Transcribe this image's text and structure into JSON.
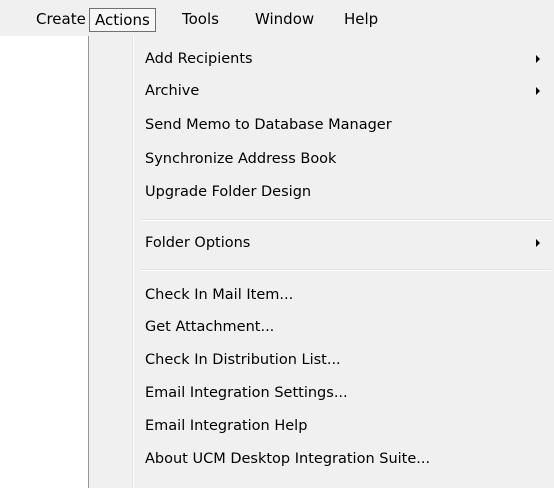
{
  "menubar": {
    "items": [
      {
        "label": "Create"
      },
      {
        "label": "Actions"
      },
      {
        "label": "Tools"
      },
      {
        "label": "Window"
      },
      {
        "label": "Help"
      }
    ]
  },
  "actions_menu": {
    "items": [
      {
        "label": "Add Recipients",
        "submenu": true
      },
      {
        "label": "Archive",
        "submenu": true
      },
      {
        "label": "Send Memo to Database Manager",
        "submenu": false
      },
      {
        "label": "Synchronize Address Book",
        "submenu": false
      },
      {
        "label": "Upgrade Folder Design",
        "submenu": false
      },
      {
        "label": "Folder Options",
        "submenu": true
      },
      {
        "label": "Check In Mail Item...",
        "submenu": false
      },
      {
        "label": "Get Attachment...",
        "submenu": false
      },
      {
        "label": "Check In Distribution List...",
        "submenu": false
      },
      {
        "label": "Email Integration Settings...",
        "submenu": false
      },
      {
        "label": "Email Integration Help",
        "submenu": false
      },
      {
        "label": "About UCM Desktop Integration Suite...",
        "submenu": false
      }
    ]
  }
}
